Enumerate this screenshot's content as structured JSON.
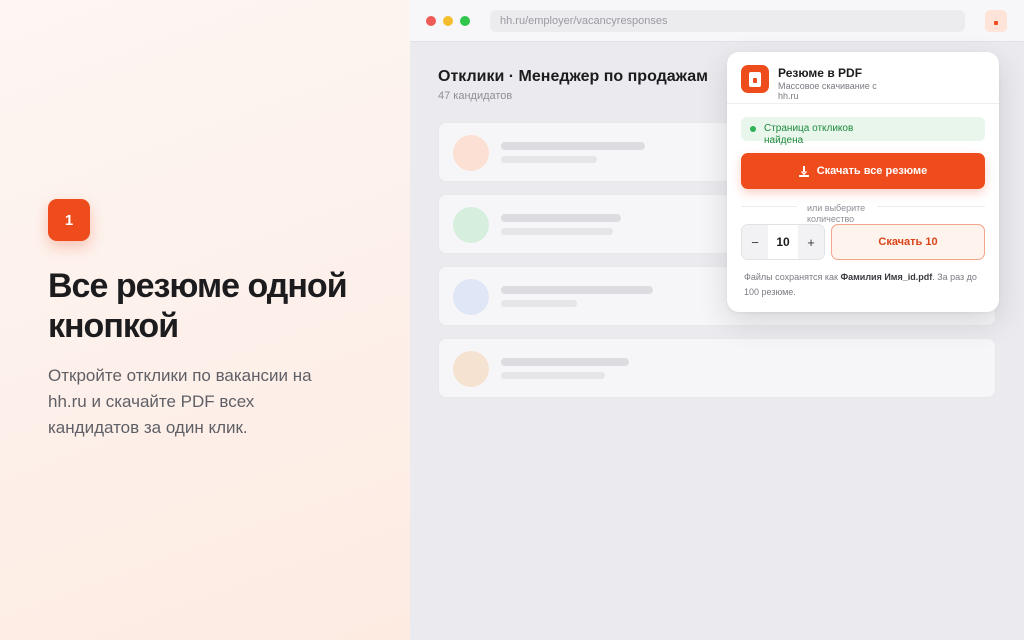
{
  "promo": {
    "step": "1",
    "headline": "Все резюме одной кнопкой",
    "description": "Откройте отклики по вакансии на hh.ru и скачайте PDF всех кандидатов за один клик."
  },
  "browser": {
    "url": "hh.ru/employer/vacancyresponses",
    "page_title": "Отклики · Менеджер по продажам",
    "page_subtitle": "47 кандидатов",
    "avatar_colors": [
      "#fbe0d3",
      "#d6eedc",
      "#dfe6f6",
      "#f6e2d0"
    ]
  },
  "popup": {
    "title": "Резюме в PDF",
    "subtitle": "Массовое скачивание с hh.ru",
    "status": "Страница откликов найдена",
    "download_all": "Скачать все резюме",
    "divider": "или выберите количество",
    "minus": "−",
    "quantity": "10",
    "plus": "+",
    "download_n": "Скачать 10",
    "note_prefix": "Файлы сохранятся как ",
    "note_filename": "Фамилия Имя_id.pdf",
    "note_suffix": ". За раз до 100 резюме."
  },
  "colors": {
    "accent": "#ee4c1c",
    "success": "#2fb052"
  }
}
